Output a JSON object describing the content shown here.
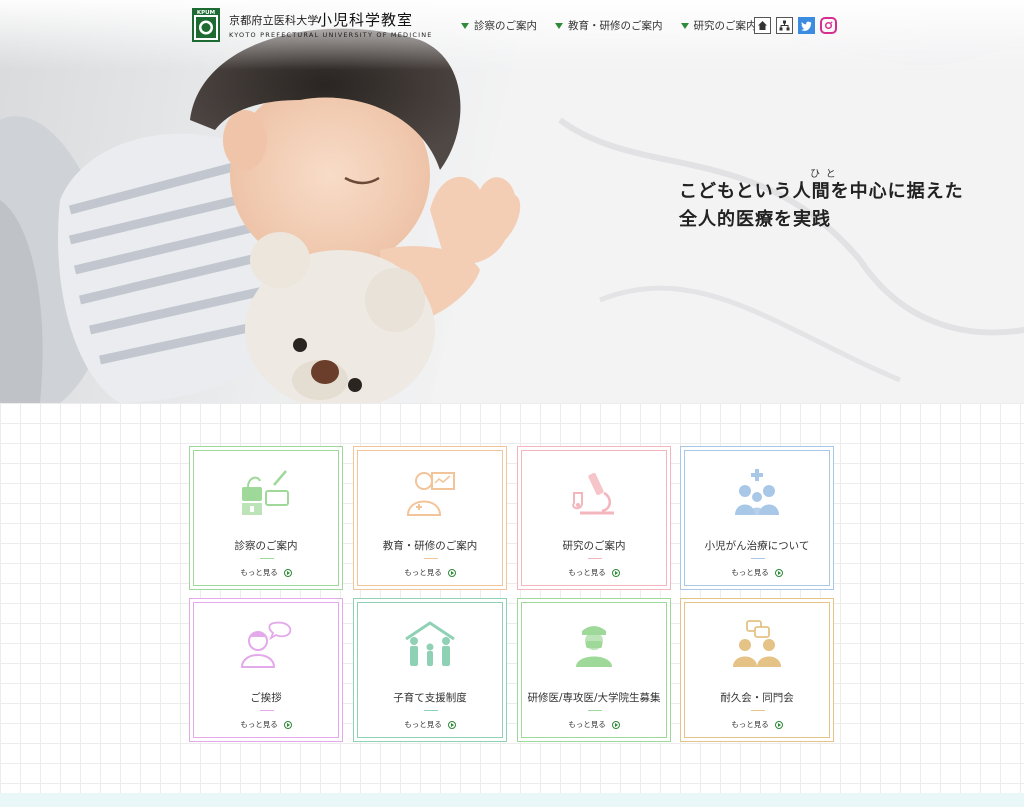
{
  "header": {
    "logo_mark_text": "KPUM",
    "logo_small": "京都府立医科大学",
    "logo_big": "小児科学教室",
    "logo_en": "KYOTO PREFECTURAL UNIVERSITY OF MEDICINE",
    "nav": [
      "診察のご案内",
      "教育・研修のご案内",
      "研究のご案内"
    ],
    "icons": [
      "home-icon",
      "sitemap-icon",
      "twitter-icon",
      "instagram-icon"
    ]
  },
  "hero": {
    "catch_line1": "こどもという人間を中心に据えた",
    "catch_line2": "全人的医療を実践",
    "ruby": "ひと"
  },
  "cards": [
    {
      "title": "診察のご案内",
      "more": "もっと見る",
      "color": "#9fd99a",
      "icon": "medical-equipment-icon"
    },
    {
      "title": "教育・研修のご案内",
      "more": "もっと見る",
      "color": "#f1c49a",
      "icon": "doctor-presentation-icon"
    },
    {
      "title": "研究のご案内",
      "more": "もっと見る",
      "color": "#f4b6bd",
      "icon": "microscope-icon"
    },
    {
      "title": "小児がん治療について",
      "more": "もっと見る",
      "color": "#a9c8e8",
      "icon": "family-medical-icon"
    },
    {
      "title": "ご挨拶",
      "more": "もっと見る",
      "color": "#e3a9ea",
      "icon": "nurse-speech-icon"
    },
    {
      "title": "子育て支援制度",
      "more": "もっと見る",
      "color": "#8fd1b4",
      "icon": "family-house-icon"
    },
    {
      "title": "研修医/専攻医/大学院生募集",
      "more": "もっと見る",
      "color": "#9fd99a",
      "icon": "surgeon-icon"
    },
    {
      "title": "耐久会・同門会",
      "more": "もっと見る",
      "color": "#e5c285",
      "icon": "meeting-people-icon"
    }
  ],
  "colors": {
    "brand_green": "#2f8a3a",
    "twitter": "#3b8ce0",
    "instagram": "#d42f8f"
  }
}
